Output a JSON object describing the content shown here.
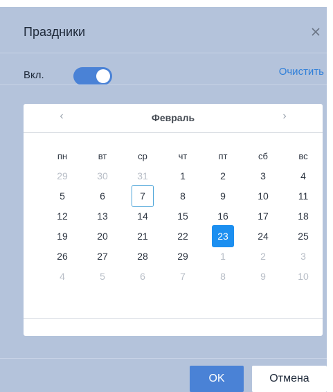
{
  "dialog": {
    "title": "Праздники",
    "close_icon": "close-icon"
  },
  "toggle": {
    "label": "Вкл.",
    "state": "on",
    "clear_label": "Очистить"
  },
  "calendar": {
    "month_label": "Февраль",
    "prev_glyph": "‹",
    "next_glyph": "›",
    "weekdays": [
      "пн",
      "вт",
      "ср",
      "чт",
      "пт",
      "сб",
      "вс"
    ],
    "weeks": [
      [
        {
          "d": "29",
          "m": true
        },
        {
          "d": "30",
          "m": true
        },
        {
          "d": "31",
          "m": true
        },
        {
          "d": "1"
        },
        {
          "d": "2"
        },
        {
          "d": "3"
        },
        {
          "d": "4"
        }
      ],
      [
        {
          "d": "5"
        },
        {
          "d": "6"
        },
        {
          "d": "7",
          "today": true
        },
        {
          "d": "8"
        },
        {
          "d": "9"
        },
        {
          "d": "10"
        },
        {
          "d": "11"
        }
      ],
      [
        {
          "d": "12"
        },
        {
          "d": "13"
        },
        {
          "d": "14"
        },
        {
          "d": "15"
        },
        {
          "d": "16"
        },
        {
          "d": "17"
        },
        {
          "d": "18"
        }
      ],
      [
        {
          "d": "19"
        },
        {
          "d": "20"
        },
        {
          "d": "21"
        },
        {
          "d": "22"
        },
        {
          "d": "23",
          "selected": true
        },
        {
          "d": "24"
        },
        {
          "d": "25"
        }
      ],
      [
        {
          "d": "26"
        },
        {
          "d": "27"
        },
        {
          "d": "28"
        },
        {
          "d": "29"
        },
        {
          "d": "1",
          "m": true
        },
        {
          "d": "2",
          "m": true
        },
        {
          "d": "3",
          "m": true
        }
      ],
      [
        {
          "d": "4",
          "m": true
        },
        {
          "d": "5",
          "m": true
        },
        {
          "d": "6",
          "m": true
        },
        {
          "d": "7",
          "m": true
        },
        {
          "d": "8",
          "m": true
        },
        {
          "d": "9",
          "m": true
        },
        {
          "d": "10",
          "m": true
        }
      ]
    ]
  },
  "buttons": {
    "ok_label": "OK",
    "cancel_label": "Отмена"
  },
  "colors": {
    "background": "#b4c3db",
    "accent": "#4a82d6",
    "selected": "#1c8ff0",
    "link": "#2f7fd9"
  }
}
